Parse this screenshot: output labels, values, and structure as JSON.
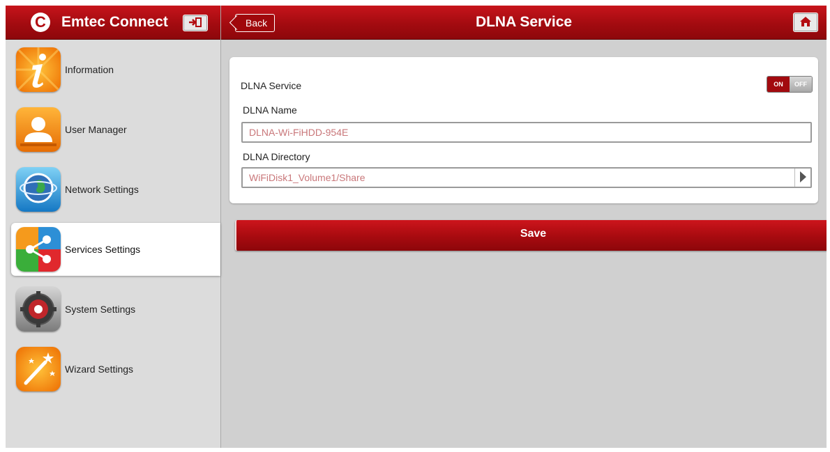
{
  "app": {
    "title": "Emtec Connect",
    "logo_glyph": "C"
  },
  "header": {
    "back_label": "Back",
    "title": "DLNA Service"
  },
  "sidebar": {
    "items": [
      {
        "label": "Information",
        "icon": "information-icon"
      },
      {
        "label": "User Manager",
        "icon": "user-icon"
      },
      {
        "label": "Network Settings",
        "icon": "globe-icon"
      },
      {
        "label": "Services Settings",
        "icon": "share-icon",
        "active": true
      },
      {
        "label": "System Settings",
        "icon": "gear-icon"
      },
      {
        "label": "Wizard Settings",
        "icon": "magic-wand-icon"
      }
    ]
  },
  "form": {
    "service_label": "DLNA Service",
    "toggle": {
      "on_label": "ON",
      "off_label": "OFF",
      "state": "on"
    },
    "name_label": "DLNA Name",
    "name_value": "DLNA-Wi-FiHDD-954E",
    "directory_label": "DLNA Directory",
    "directory_value": "WiFiDisk1_Volume1/Share"
  },
  "actions": {
    "save_label": "Save"
  },
  "colors": {
    "brand_red": "#b30d12",
    "background": "#d0d0d0",
    "field_text": "#c9777a"
  }
}
